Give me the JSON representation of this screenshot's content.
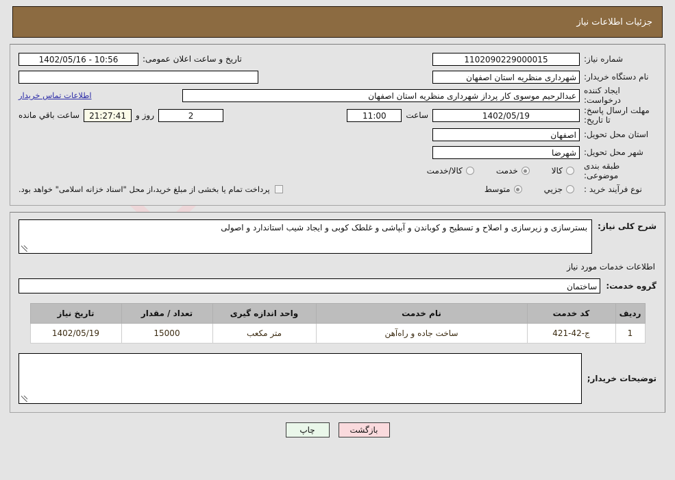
{
  "header": {
    "title": "جزئیات اطلاعات نیاز"
  },
  "top": {
    "need_number_label": "شماره نیاز:",
    "need_number_value": "1102090229000015",
    "announce_label": "تاریخ و ساعت اعلان عمومی:",
    "announce_value": "10:56 - 1402/05/16",
    "buyer_org_label": "نام دستگاه خریدار:",
    "buyer_org_value": "شهرداری منظریه استان اصفهان",
    "blank_field_value": "",
    "creator_label": "ایجاد کننده درخواست:",
    "creator_value": "عبدالرحیم موسوی کار پرداز  شهرداری منظریه استان اصفهان",
    "contact_link": "اطلاعات تماس خریدار",
    "deadline_label": "مهلت ارسال پاسخ: تا تاریخ:",
    "deadline_date": "1402/05/19",
    "hour_label": "ساعت",
    "deadline_time": "11:00",
    "days_value": "2",
    "days_label": "روز و",
    "remaining_time": "21:27:41",
    "remaining_label": "ساعت باقي مانده",
    "province_label": "استان محل تحویل:",
    "province_value": "اصفهان",
    "city_label": "شهر محل تحویل:",
    "city_value": "شهرضا",
    "category_label": "طبقه بندی موضوعی:",
    "category_options": [
      {
        "label": "کالا",
        "checked": false
      },
      {
        "label": "خدمت",
        "checked": true
      },
      {
        "label": "کالا/خدمت",
        "checked": false
      }
    ],
    "process_label": "نوع فرآیند خرید :",
    "process_options": [
      {
        "label": "جزیي",
        "checked": false
      },
      {
        "label": "متوسط",
        "checked": true
      }
    ],
    "treasury_checkbox_checked": false,
    "treasury_text": "پرداخت تمام یا بخشی از مبلغ خرید،از محل \"اسناد خزانه اسلامی\" خواهد بود."
  },
  "body": {
    "summary_label": "شرح کلی نیاز:",
    "summary_value": "بسترسازی و زیرسازی و اصلاح و تسطیح و کوباندن و آبپاشی و غلطک کوبی و ایجاد شیب استاندارد و اصولی",
    "services_section_title": "اطلاعات خدمات مورد نیاز",
    "service_group_label": "گروه خدمت:",
    "service_group_value": "ساختمان",
    "table": {
      "columns": [
        "ردیف",
        "کد خدمت",
        "نام خدمت",
        "واحد اندازه گیری",
        "تعداد / مقدار",
        "تاریخ نیاز"
      ],
      "rows": [
        {
          "row_no": "1",
          "service_code": "ج-42-421",
          "service_name": "ساخت جاده و راه‌آهن",
          "unit": "متر مکعب",
          "quantity": "15000",
          "need_date": "1402/05/19"
        }
      ]
    },
    "buyer_notes_label": "توضیحات خریدار;",
    "buyer_notes_value": ""
  },
  "footer": {
    "print_label": "چاپ",
    "back_label": "بازگشت"
  },
  "colors": {
    "header_bg": "#8c6b41",
    "page_bg": "#e4e4e4",
    "table_header_bg": "#bdbdbd",
    "link": "#2c2ca8",
    "back_btn_bg": "#fadadd",
    "print_btn_bg": "#eaf7ea"
  },
  "watermark": {
    "brand": "AriaTender",
    "suffix": ".net"
  }
}
